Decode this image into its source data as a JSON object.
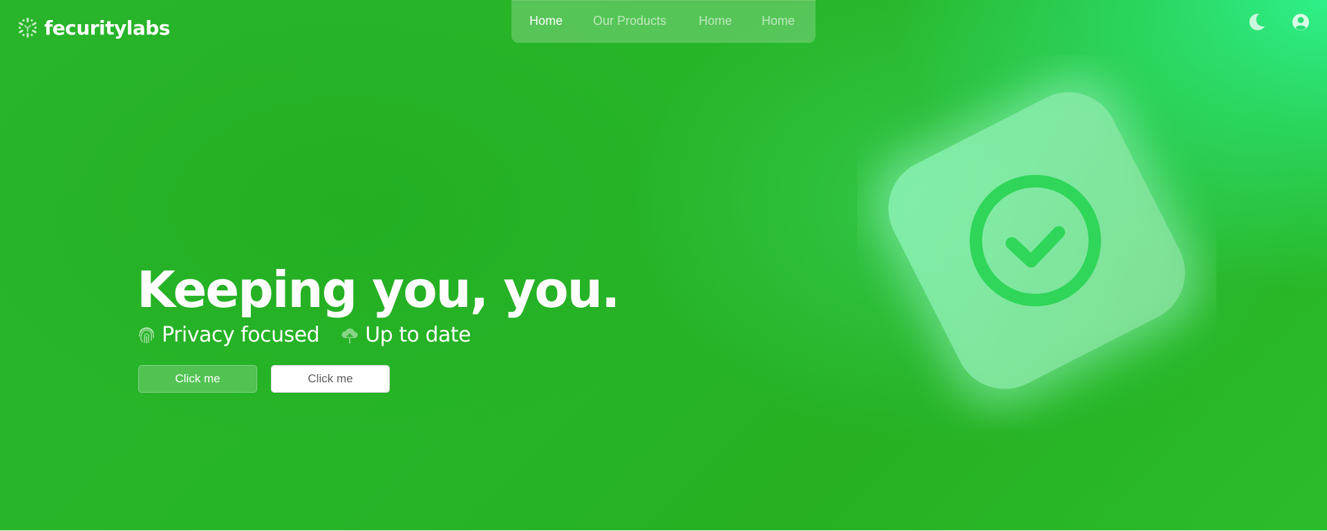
{
  "brand": {
    "name": "fecuritylabs",
    "logo_icon": "hexagon-dots-icon"
  },
  "nav": {
    "items": [
      {
        "label": "Home",
        "active": true
      },
      {
        "label": "Our Products",
        "active": false
      },
      {
        "label": "Home",
        "active": false
      },
      {
        "label": "Home",
        "active": false
      }
    ]
  },
  "header_actions": {
    "theme_toggle_icon": "moon-icon",
    "account_icon": "user-circle-icon"
  },
  "hero": {
    "headline": "Keeping you, you.",
    "features": [
      {
        "icon": "fingerprint-icon",
        "label": "Privacy focused"
      },
      {
        "icon": "cloud-upload-icon",
        "label": "Up to date"
      }
    ],
    "primary_button": "Click me",
    "secondary_button": "Click me",
    "illustration_icon": "check-badge-icon"
  },
  "colors": {
    "background_green": "#27b528",
    "accent_green": "#2ef08a",
    "checkmark_green": "#2fd65a",
    "text": "#ffffff"
  }
}
